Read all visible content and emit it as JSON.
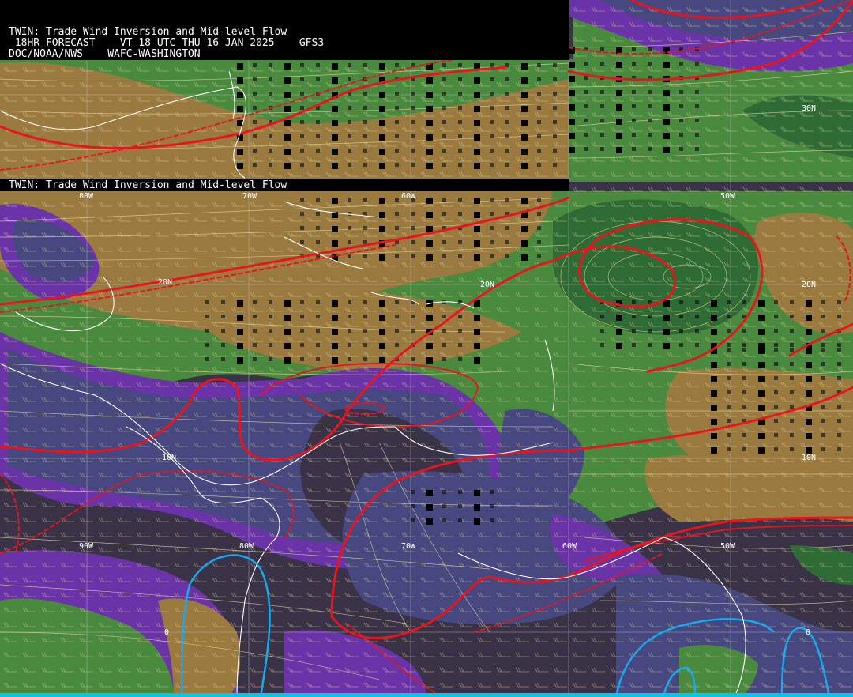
{
  "header": {
    "line1": "TWIN: Trade Wind Inversion and Mid-level Flow",
    "line2": " 18HR FORECAST    VT 18 UTC THU 16 JAN 2025    GFS3",
    "line3": "DOC/NOAA/NWS    WAFC-WASHINGTON",
    "mid_title": "TWIN: Trade Wind Inversion and Mid-level Flow"
  },
  "map_labels": {
    "lat_30n": "30N",
    "lat_20n_a": "20N",
    "lat_20n_b": "20N",
    "lat_20n_c": "20N",
    "lat_10n_a": "10N",
    "lat_10n_b": "10N",
    "lon_80w": "80W",
    "lon_70w": "70W",
    "lon_60w": "60W",
    "lon_50w_a": "50W",
    "lon_50w_b": "50W",
    "lon_90w": "90W",
    "lon_80w_b": "80W",
    "lat_0_a": "0",
    "lat_0_b": "0"
  },
  "colors": {
    "tan": "#9a7a3f",
    "green_dark": "#2f6b35",
    "green": "#4a8a3e",
    "purple": "#6a34a8",
    "slate": "#46487f",
    "dark": "#3a3348",
    "red_line": "#e8141e",
    "cyan_line": "#19a9ee",
    "coast": "#ffffff",
    "wind": "#e8d8a0"
  }
}
